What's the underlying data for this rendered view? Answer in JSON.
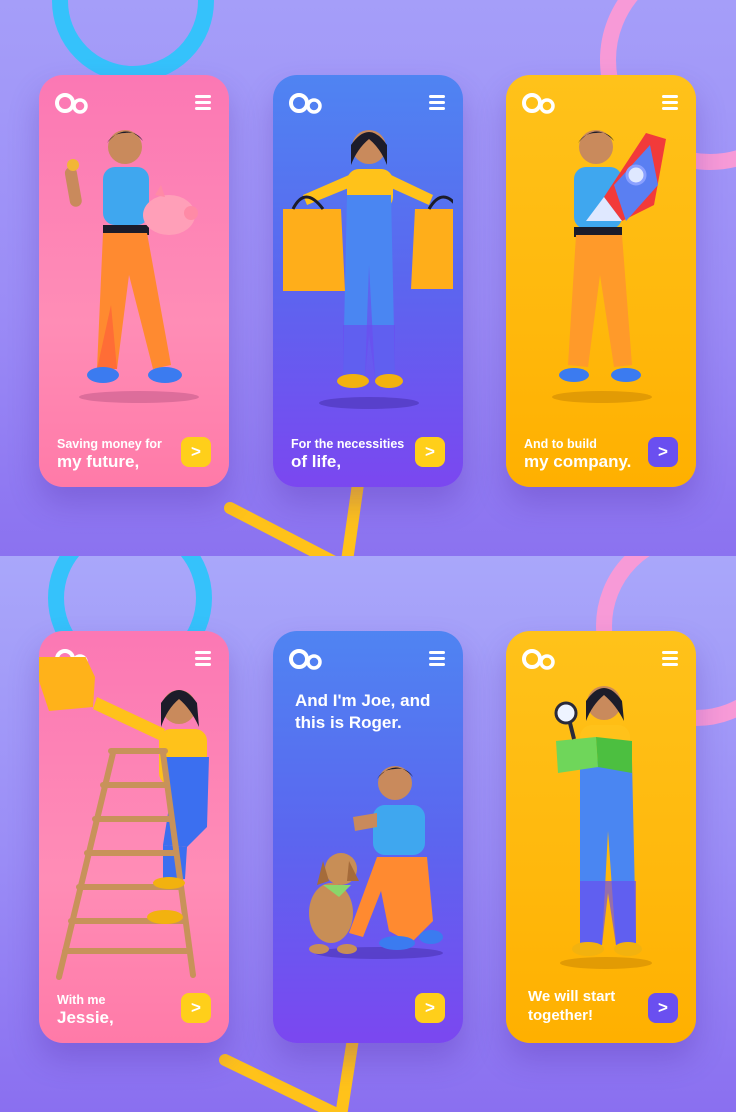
{
  "top_row": {
    "cards": [
      {
        "caption_small": "Saving money for",
        "caption_big": "my future,",
        "next_button": ">"
      },
      {
        "caption_small": "For the necessities",
        "caption_big": "of life,",
        "next_button": ">"
      },
      {
        "caption_small": "And to build",
        "caption_big": "my company.",
        "next_button": ">"
      }
    ]
  },
  "bottom_row": {
    "cards": [
      {
        "caption_small": "With me",
        "caption_big": "Jessie,",
        "next_button": ">"
      },
      {
        "heading": "And I'm Joe, and this is Roger.",
        "next_button": ">"
      },
      {
        "caption": "We will start together!",
        "next_button": ">"
      }
    ]
  },
  "icons": {
    "logo": "brand-logo-icon",
    "menu": "hamburger-menu-icon",
    "next": "chevron-right-icon"
  },
  "colors": {
    "pink_card": "#fb78b4",
    "blue_card": "#5b66ef",
    "yellow_card": "#ffc21a",
    "yellow_button": "#ffcf1a",
    "purple_button": "#6a4ff0",
    "ring_blue": "#35c2fb",
    "ring_pink": "#f79ad7",
    "triangle_yellow": "#ffc21a",
    "background": "#9d8cf5"
  }
}
